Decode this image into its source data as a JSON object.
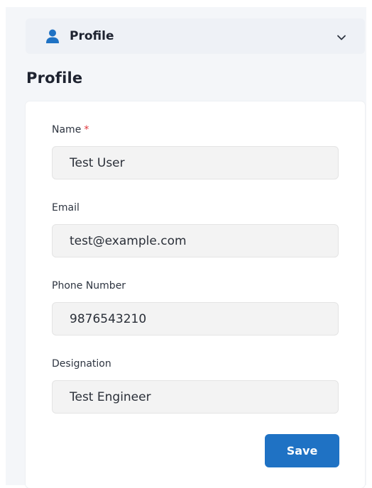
{
  "accordion": {
    "label": "Profile",
    "icon": "user-icon",
    "toggle_icon": "chevron-down-icon"
  },
  "page": {
    "title": "Profile"
  },
  "form": {
    "fields": [
      {
        "label": "Name",
        "required_mark": "*",
        "value": "Test User"
      },
      {
        "label": "Email",
        "value": "test@example.com"
      },
      {
        "label": "Phone Number",
        "value": "9876543210"
      },
      {
        "label": "Designation",
        "value": "Test Engineer"
      }
    ],
    "save_label": "Save"
  },
  "colors": {
    "accent": "#1f72c4",
    "required": "#e0343a",
    "input_bg": "#f3f3f3",
    "panel_bg": "#eef1f6",
    "page_bg": "#f4f6f9"
  }
}
